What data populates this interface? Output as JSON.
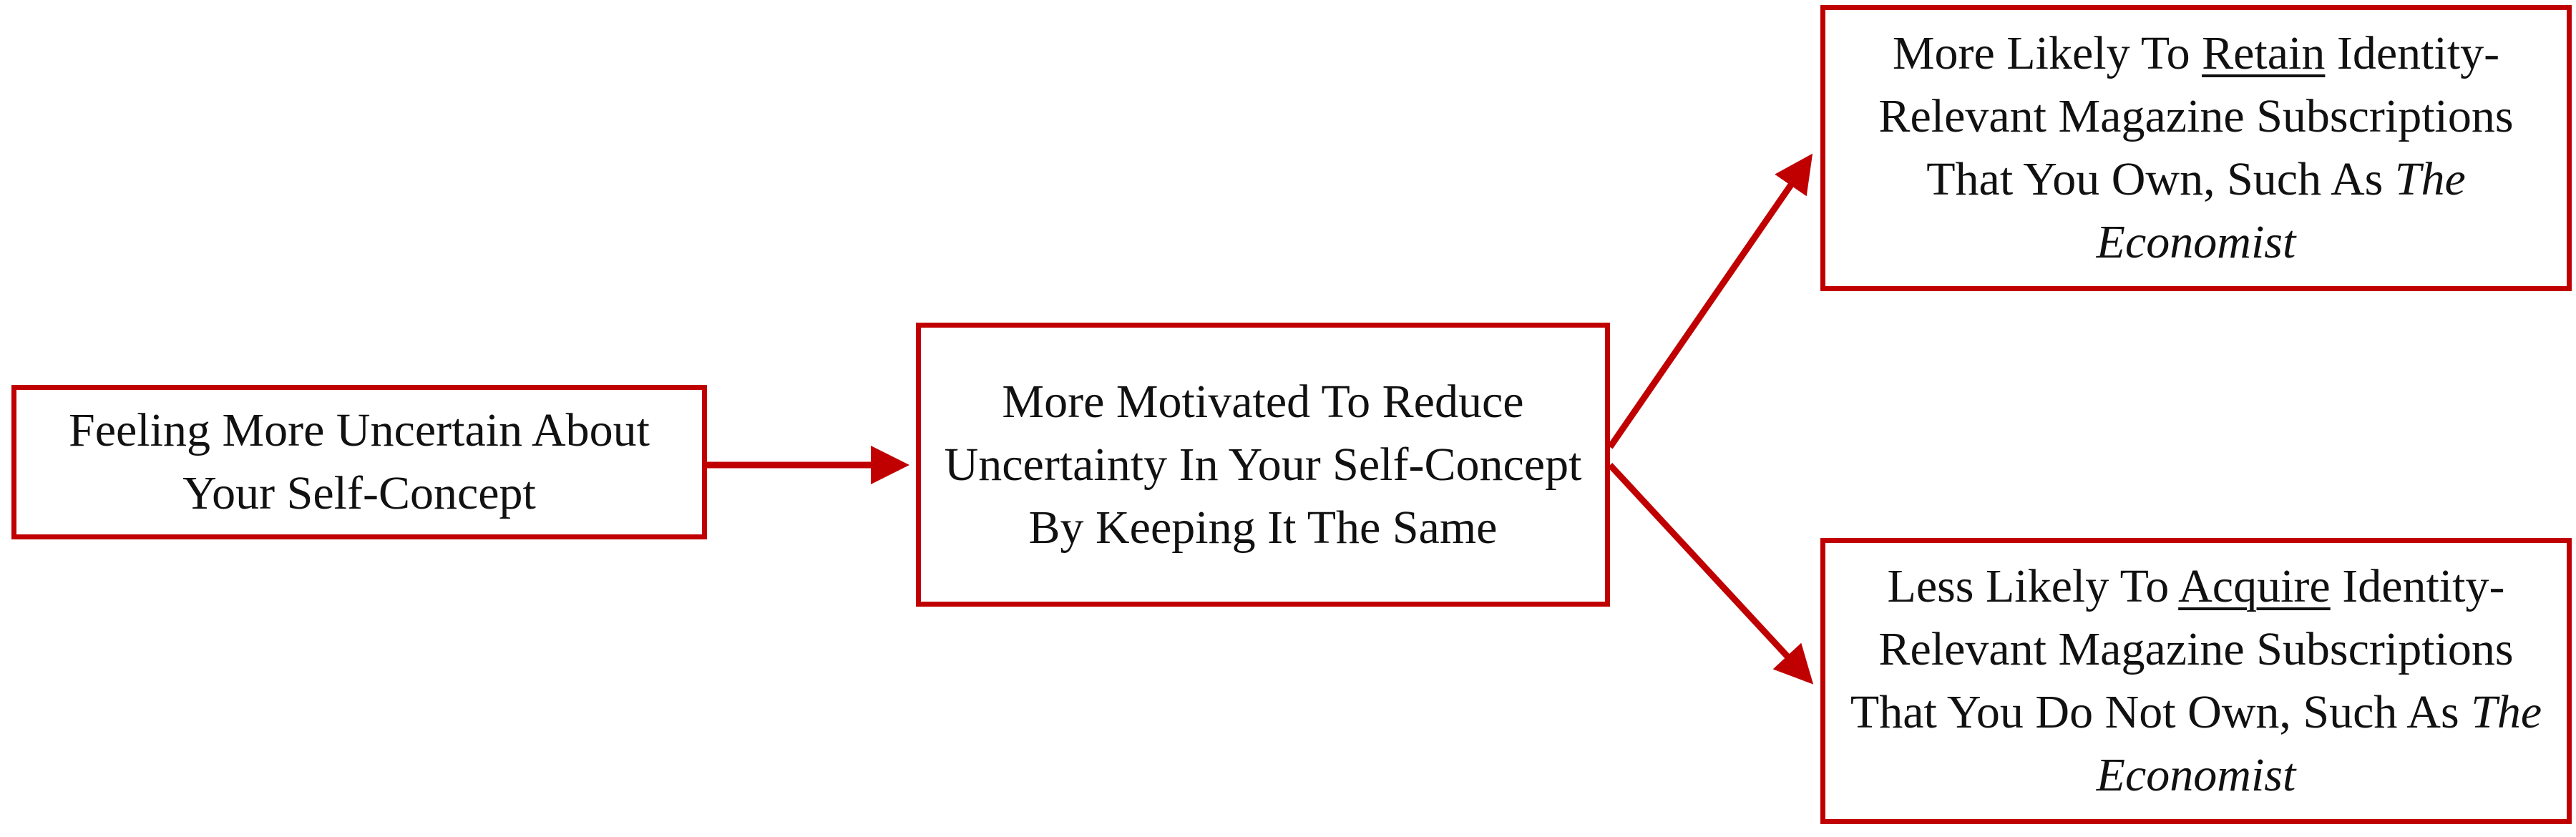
{
  "colors": {
    "accent": "#c00000",
    "text": "#111111",
    "background": "#ffffff"
  },
  "boxes": {
    "cause": {
      "text": "Feeling More Uncertain About Your Self-Concept"
    },
    "mediator": {
      "text": "More Motivated To Reduce Uncertainty In Your Self-Concept By Keeping It The Same"
    },
    "retain": {
      "prefix": "More Likely To ",
      "emphasis": "Retain",
      "middle": " Identity-Relevant Magazine Subscriptions That You Own, Such As ",
      "title": "The Economist"
    },
    "acquire": {
      "prefix": "Less Likely To ",
      "emphasis": "Acquire",
      "middle": " Identity-Relevant Magazine Subscriptions That You Do Not Own, Such As ",
      "title": "The Economist"
    }
  }
}
